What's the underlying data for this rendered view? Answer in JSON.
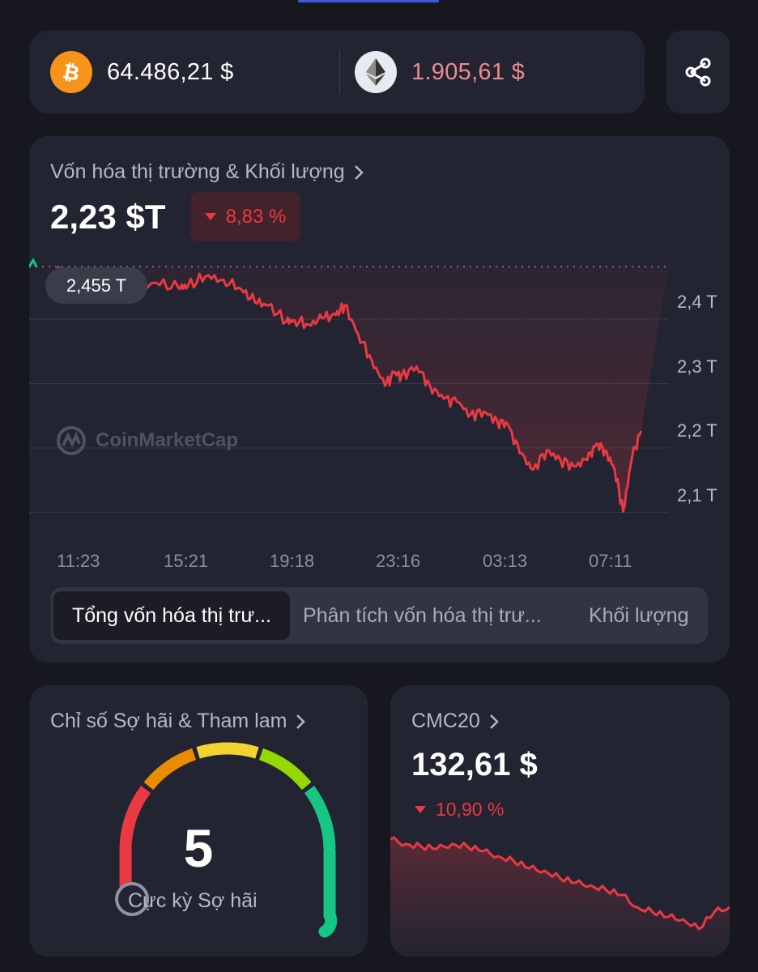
{
  "prices": {
    "btc": {
      "icon": "bitcoin-icon",
      "price": "64.486,21 $",
      "color": "#ffffff"
    },
    "eth": {
      "icon": "ethereum-icon",
      "price": "1.905,61 $",
      "color": "#f08a8f"
    }
  },
  "share": {
    "icon": "share-icon"
  },
  "market_cap": {
    "title": "Vốn hóa thị trường & Khối lượng",
    "value": "2,23 $T",
    "change": "8,83 %",
    "change_direction": "down",
    "hover_label": "2,455 T",
    "watermark": "CoinMarketCap",
    "tabs": [
      "Tổng vốn hóa thị trư...",
      "Phân tích vốn hóa thị trư...",
      "Khối lượng"
    ],
    "active_tab": 0,
    "chart_data": {
      "type": "line",
      "xlabel": "",
      "ylabel": "",
      "x_ticks": [
        "11:23",
        "15:21",
        "19:18",
        "23:16",
        "03:13",
        "07:11"
      ],
      "y_ticks": [
        "2,4 T",
        "2,3 T",
        "2,2 T",
        "2,1 T"
      ],
      "y_unit": "T",
      "ylim": [
        2.04,
        2.48
      ],
      "reference_line": 2.455,
      "series": [
        {
          "color": "#ea3943",
          "x": [
            "10:30",
            "11:23",
            "12:20",
            "13:10",
            "14:10",
            "15:00",
            "15:21",
            "16:00",
            "16:40",
            "17:20",
            "17:50",
            "18:20",
            "19:00",
            "19:18",
            "19:50",
            "20:20",
            "20:50",
            "21:10",
            "21:40",
            "22:10",
            "22:40",
            "23:00",
            "23:16",
            "23:50",
            "00:20",
            "00:50",
            "01:20",
            "01:50",
            "02:20",
            "02:50",
            "03:13",
            "03:40",
            "04:10",
            "04:40",
            "05:10",
            "05:40",
            "06:10",
            "06:30",
            "06:50",
            "07:11",
            "07:30",
            "07:50",
            "08:10"
          ],
          "values": [
            2.455,
            2.436,
            2.425,
            2.415,
            2.43,
            2.422,
            2.425,
            2.44,
            2.435,
            2.42,
            2.4,
            2.395,
            2.37,
            2.372,
            2.365,
            2.375,
            2.38,
            2.395,
            2.35,
            2.31,
            2.27,
            2.29,
            2.285,
            2.3,
            2.27,
            2.25,
            2.245,
            2.225,
            2.23,
            2.215,
            2.21,
            2.165,
            2.14,
            2.17,
            2.155,
            2.145,
            2.155,
            2.18,
            2.17,
            2.14,
            2.075,
            2.16,
            2.2
          ]
        }
      ]
    }
  },
  "fear_greed": {
    "title": "Chỉ số Sợ hãi & Tham lam",
    "value": "5",
    "label": "Cực kỳ Sợ hãi",
    "segment_colors": [
      "#ea3943",
      "#ea8c00",
      "#f3d42f",
      "#93d900",
      "#16c784"
    ],
    "level": 0.05
  },
  "cmc20": {
    "title": "CMC20",
    "value": "132,61 $",
    "change": "10,90 %",
    "change_direction": "down",
    "chart_data": {
      "type": "area",
      "xlabel": "",
      "ylabel": "",
      "series": [
        {
          "color": "#ea3943",
          "values": [
            1.0,
            0.99,
            0.985,
            0.98,
            0.99,
            0.985,
            0.975,
            0.965,
            0.955,
            0.94,
            0.935,
            0.92,
            0.91,
            0.905,
            0.895,
            0.885,
            0.86,
            0.85,
            0.84,
            0.835,
            0.815,
            0.85,
            0.86
          ]
        }
      ]
    }
  }
}
